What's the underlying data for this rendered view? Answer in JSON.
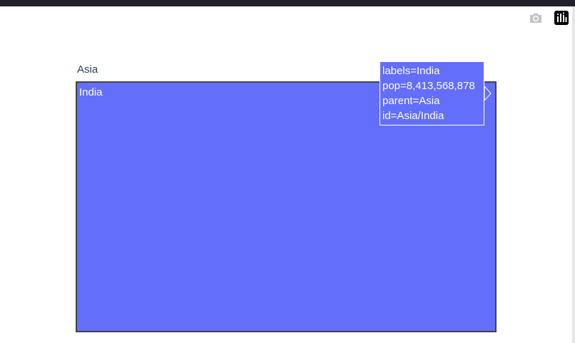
{
  "modebar": {
    "items": [
      "camera-icon",
      "plotly-logo-icon"
    ]
  },
  "treemap": {
    "path": "Asia",
    "tile": {
      "label": "India",
      "color": "#636efa",
      "border_color": "#444444"
    },
    "hover": {
      "lines": [
        "labels=India",
        "pop=8,413,568,878",
        "parent=Asia",
        "id=Asia/India"
      ]
    }
  },
  "colors": {
    "topbar": "#1f2129",
    "path_text": "#2a3f5f",
    "tile_fill": "#636efa"
  }
}
